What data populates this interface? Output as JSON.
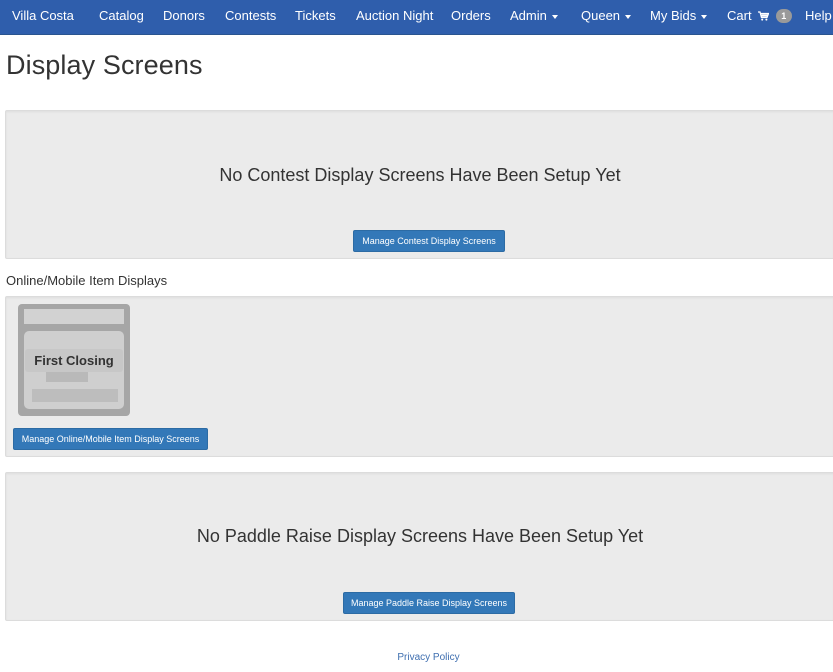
{
  "navbar": {
    "brand": "Villa Costa",
    "items": [
      {
        "label": "Catalog"
      },
      {
        "label": "Donors"
      },
      {
        "label": "Contests"
      },
      {
        "label": "Tickets"
      },
      {
        "label": "Auction Night"
      },
      {
        "label": "Orders"
      },
      {
        "label": "Admin"
      },
      {
        "label": "Queen"
      },
      {
        "label": "My Bids"
      },
      {
        "label": "Cart"
      },
      {
        "label": "Help"
      }
    ],
    "cart_count": "1"
  },
  "page": {
    "title": "Display Screens"
  },
  "contest_panel": {
    "message": "No Contest Display Screens Have Been Setup Yet",
    "button": "Manage Contest Display Screens"
  },
  "online_panel": {
    "section_label": "Online/Mobile Item Displays",
    "card_label": "First Closing",
    "button": "Manage Online/Mobile Item Display Screens"
  },
  "paddle_panel": {
    "message": "No Paddle Raise Display Screens Have Been Setup Yet",
    "button": "Manage Paddle Raise Display Screens"
  },
  "footer": {
    "privacy": "Privacy Policy"
  },
  "colors": {
    "navbar": "#2f5eac",
    "button": "#3378b8",
    "well": "#ebebeb",
    "link": "#3f6fb0"
  }
}
